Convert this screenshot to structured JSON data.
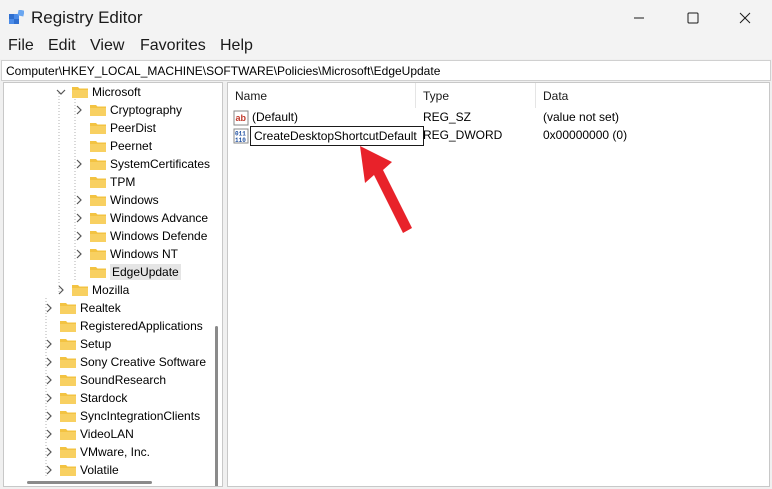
{
  "window": {
    "title": "Registry Editor",
    "controls": [
      "minimize-icon",
      "maximize-icon",
      "close-icon"
    ]
  },
  "menu": [
    "File",
    "Edit",
    "View",
    "Favorites",
    "Help"
  ],
  "address": "Computer\\HKEY_LOCAL_MACHINE\\SOFTWARE\\Policies\\Microsoft\\EdgeUpdate",
  "tree": [
    {
      "label": "Microsoft",
      "expanded": true
    },
    {
      "label": "Cryptography",
      "expandable": true
    },
    {
      "label": "PeerDist",
      "expandable": false
    },
    {
      "label": "Peernet",
      "expandable": false
    },
    {
      "label": "SystemCertificates",
      "expandable": true
    },
    {
      "label": "TPM",
      "expandable": false
    },
    {
      "label": "Windows",
      "expandable": true
    },
    {
      "label": "Windows Advance",
      "expandable": true
    },
    {
      "label": "Windows Defende",
      "expandable": true
    },
    {
      "label": "Windows NT",
      "expandable": true
    },
    {
      "label": "EdgeUpdate",
      "expandable": false,
      "selected": true
    },
    {
      "label": "Mozilla",
      "expandable": true
    },
    {
      "label": "Realtek",
      "expandable": true
    },
    {
      "label": "RegisteredApplications",
      "expandable": false
    },
    {
      "label": "Setup",
      "expandable": true
    },
    {
      "label": "Sony Creative Software",
      "expandable": true
    },
    {
      "label": "SoundResearch",
      "expandable": true
    },
    {
      "label": "Stardock",
      "expandable": true
    },
    {
      "label": "SyncIntegrationClients",
      "expandable": true
    },
    {
      "label": "VideoLAN",
      "expandable": true
    },
    {
      "label": "VMware, Inc.",
      "expandable": true
    },
    {
      "label": "Volatile",
      "expandable": true
    }
  ],
  "columns": {
    "name": "Name",
    "type": "Type",
    "data": "Data"
  },
  "values": [
    {
      "name": "(Default)",
      "type": "REG_SZ",
      "data": "(value not set)",
      "icon": "string-value-icon"
    },
    {
      "name": "CreateDesktopShortcutDefault",
      "type": "REG_DWORD",
      "data": "0x00000000 (0)",
      "icon": "binary-value-icon",
      "renaming": true
    }
  ],
  "colors": {
    "folder": "#f3c342",
    "selection": "#e5e5e5",
    "annotation_arrow": "#e8222a"
  }
}
